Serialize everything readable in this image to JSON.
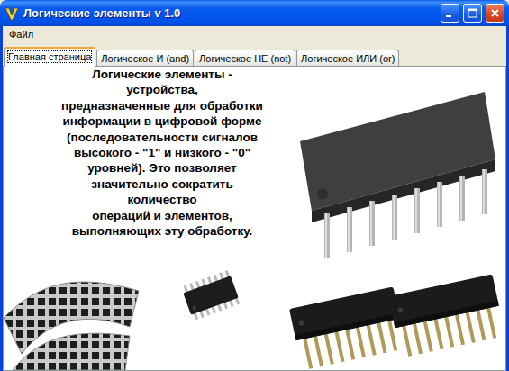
{
  "window": {
    "title": "Логические элементы v 1.0"
  },
  "menu": [
    {
      "label": "Файл"
    }
  ],
  "tabs": [
    {
      "label": "Главная страница",
      "selected": true
    },
    {
      "label": "Логическое И (and)",
      "selected": false
    },
    {
      "label": "Логическое НЕ (not)",
      "selected": false
    },
    {
      "label": "Логическое ИЛИ (or)",
      "selected": false
    }
  ],
  "description": {
    "lines": [
      "Логические элементы -",
      "устройства,",
      "предназначенные для обработки",
      "информации в цифровой форме",
      "(последовательности сигналов",
      "высокого - \"1\" и низкого - \"0\"",
      "уровней). Это позволяет",
      "значительно сократить",
      "количество",
      "операций и элементов,",
      "выполняющих эту обработку."
    ]
  }
}
